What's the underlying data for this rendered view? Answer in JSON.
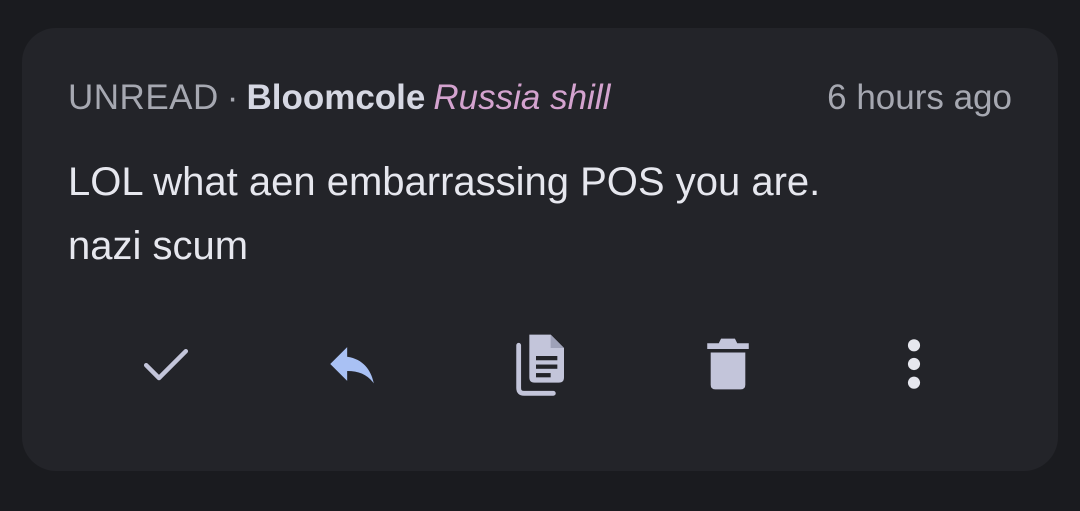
{
  "notification": {
    "status": "UNREAD",
    "separator": "·",
    "author": "Bloomcole",
    "flair": "Russia shill",
    "time": "6 hours ago",
    "body_lines": [
      "LOL what aen embarrassing POS you are.",
      "nazi scum"
    ]
  },
  "actions": [
    {
      "icon": "checkmark-icon",
      "action": "mark-read"
    },
    {
      "icon": "reply-icon",
      "action": "reply"
    },
    {
      "icon": "copy-document-icon",
      "action": "copy"
    },
    {
      "icon": "trash-icon",
      "action": "delete"
    },
    {
      "icon": "more-vertical-icon",
      "action": "more-options"
    }
  ],
  "colors": {
    "background": "#1a1b1f",
    "card": "#232429",
    "meta_text": "#a6a8b1",
    "author_text": "#d6d8e3",
    "flair_text": "#d4a3cf",
    "body_text": "#e6e7ee",
    "icon": "#c3c5da",
    "reply_icon": "#a9c1f4"
  }
}
